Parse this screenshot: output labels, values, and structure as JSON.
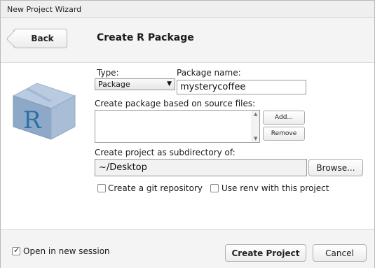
{
  "window": {
    "title": "New Project Wizard"
  },
  "header": {
    "back_label": "Back",
    "page_title": "Create R Package"
  },
  "logo": {
    "letter": "R"
  },
  "form": {
    "type_label": "Type:",
    "type_value": "Package",
    "package_name_label": "Package name:",
    "package_name_value": "mysterycoffee",
    "source_files_label": "Create package based on source files:",
    "add_label": "Add...",
    "remove_label": "Remove",
    "subdir_label": "Create project as subdirectory of:",
    "subdir_value": "~/Desktop",
    "browse_label": "Browse...",
    "git_label": "Create a git repository",
    "git_checked": false,
    "renv_label": "Use renv with this project",
    "renv_checked": false
  },
  "footer": {
    "new_session_label": "Open in new session",
    "new_session_checked": true,
    "create_label": "Create Project",
    "cancel_label": "Cancel"
  },
  "colors": {
    "logo_box": "#8aa4c4",
    "logo_letter": "#2d6fa6"
  },
  "icons": [
    "r-package-icon",
    "dropdown-caret-icon",
    "scroll-up-icon",
    "scroll-down-icon",
    "check-icon",
    "back-arrow-icon"
  ]
}
